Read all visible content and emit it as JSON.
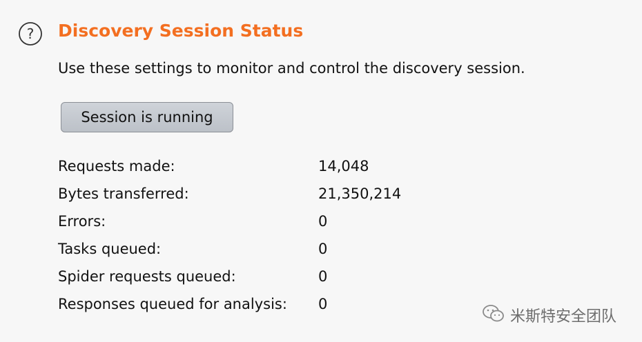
{
  "section": {
    "icon": "help-circle-icon",
    "title": "Discovery Session Status",
    "description": "Use these settings to monitor and control the discovery session.",
    "accent_color": "#f36f21"
  },
  "session_button": {
    "label": "Session is running"
  },
  "stats": [
    {
      "label": "Requests made:",
      "value": "14,048"
    },
    {
      "label": "Bytes transferred:",
      "value": "21,350,214"
    },
    {
      "label": "Errors:",
      "value": "0"
    },
    {
      "label": "Tasks queued:",
      "value": "0"
    },
    {
      "label": "Spider requests queued:",
      "value": "0"
    },
    {
      "label": "Responses queued for analysis:",
      "value": "0"
    }
  ],
  "watermark": {
    "icon": "wechat-icon",
    "text": "米斯特安全团队"
  }
}
